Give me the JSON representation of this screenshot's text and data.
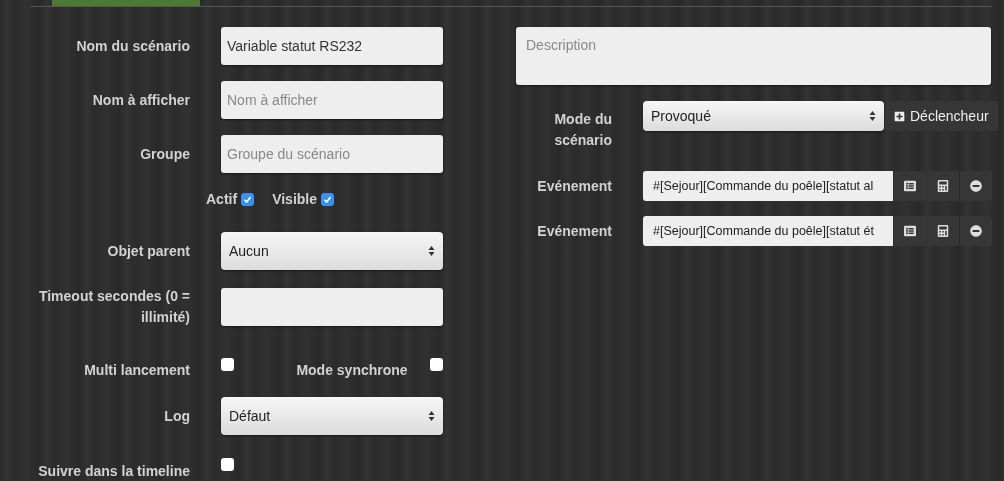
{
  "form": {
    "rows": [
      {
        "kind": "text",
        "label": "Nom du scénario",
        "value": "Variable statut RS232"
      },
      {
        "kind": "text",
        "label": "Nom à afficher",
        "placeholder": "Nom à afficher"
      },
      {
        "kind": "text",
        "label": "Groupe",
        "placeholder": "Groupe du scénario"
      },
      {
        "kind": "flags",
        "items": [
          {
            "label": "Actif",
            "checked": true
          },
          {
            "label": "Visible",
            "checked": true
          }
        ]
      },
      {
        "kind": "select",
        "label": "Objet parent",
        "value": "Aucun"
      },
      {
        "kind": "text",
        "label": "Timeout secondes (0 = illimité)"
      },
      {
        "kind": "pair",
        "label": "Multi lancement",
        "checked": false,
        "second_label": "Mode synchrone",
        "second_checked": false
      },
      {
        "kind": "select",
        "label": "Log",
        "value": "Défaut"
      },
      {
        "kind": "checkbox",
        "label": "Suivre dans la timeline",
        "checked": false
      }
    ]
  },
  "description": {
    "placeholder": "Description"
  },
  "mode": {
    "label": "Mode du scénario",
    "value": "Provoqué",
    "button": "Déclencheur"
  },
  "events": [
    {
      "label": "Evénement",
      "value": "#[Sejour][Commande du poêle][statut al"
    },
    {
      "label": "Evénement",
      "value": "#[Sejour][Commande du poêle][statut ét"
    }
  ]
}
